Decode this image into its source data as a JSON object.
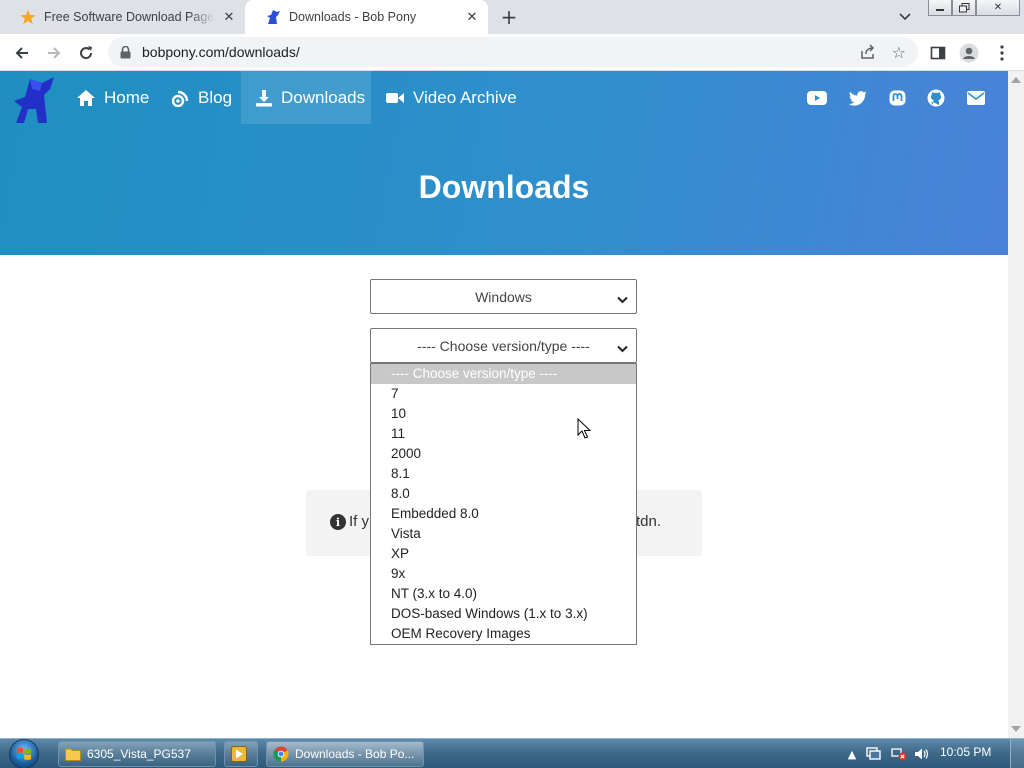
{
  "browser": {
    "tabs": [
      {
        "title": "Free Software Download Page - Bob Pony",
        "active": false
      },
      {
        "title": "Downloads - Bob Pony",
        "active": true
      }
    ],
    "url": "bobpony.com/downloads/"
  },
  "site": {
    "nav": [
      {
        "label": "Home",
        "icon": "home-icon"
      },
      {
        "label": "Blog",
        "icon": "blog-icon"
      },
      {
        "label": "Downloads",
        "icon": "download-icon"
      },
      {
        "label": "Video Archive",
        "icon": "video-camera-icon"
      }
    ],
    "social_icons": [
      "youtube-icon",
      "twitter-icon",
      "mastodon-icon",
      "github-icon",
      "email-icon"
    ],
    "page_title": "Downloads"
  },
  "main": {
    "os_select": {
      "selected": "Windows"
    },
    "version_select": {
      "selected": "---- Choose version/type ----",
      "options": [
        "---- Choose version/type ----",
        "7",
        "10",
        "11",
        "2000",
        "8.1",
        "8.0",
        "Embedded 8.0",
        "Vista",
        "XP",
        "9x",
        "NT (3.x to 4.0)",
        "DOS-based Windows (1.x to 3.x)",
        "OEM Recovery Images"
      ],
      "highlighted_index": 0
    },
    "info": {
      "text_left": "If y",
      "text_right": "tdn."
    }
  },
  "taskbar": {
    "buttons": [
      {
        "label": "6305_Vista_PG537",
        "icon": "folder-icon"
      },
      {
        "label": "",
        "icon": "media-player-icon"
      },
      {
        "label": "Downloads - Bob Po...",
        "icon": "chrome-icon"
      }
    ],
    "clock": "10:05 PM"
  },
  "colors": {
    "hero_start": "#1f8fc0",
    "hero_end": "#4a82d8",
    "accent": "#2f8fcd"
  }
}
